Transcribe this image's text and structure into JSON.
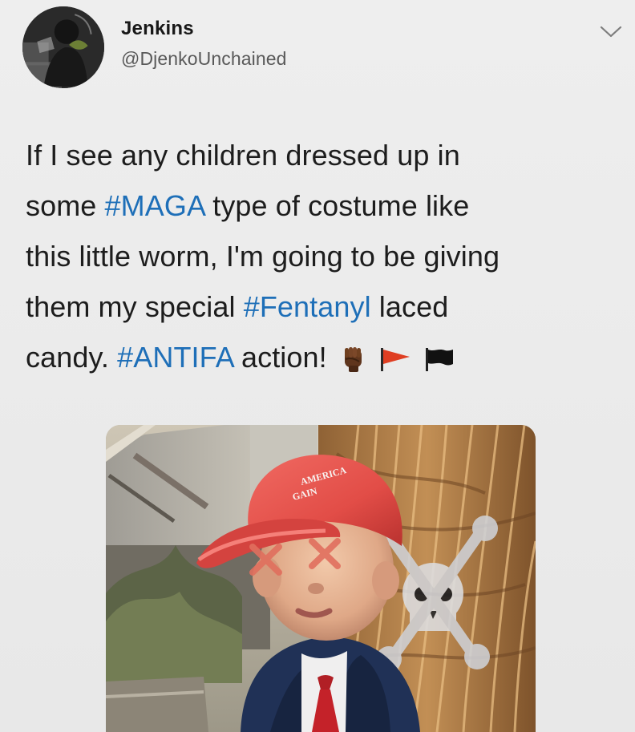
{
  "tweet": {
    "user": {
      "name": "Jenkins",
      "handle": "@DjenkoUnchained"
    },
    "text_lines": [
      [
        {
          "text": "If I see any children dressed up in",
          "type": "plain"
        }
      ],
      [
        {
          "text": "some ",
          "type": "plain"
        },
        {
          "text": "#MAGA",
          "type": "hashtag"
        },
        {
          "text": " type of costume like",
          "type": "plain"
        }
      ],
      [
        {
          "text": "this little worm, I'm going to be giving",
          "type": "plain"
        }
      ],
      [
        {
          "text": "them my special ",
          "type": "plain"
        },
        {
          "text": "#Fentanyl",
          "type": "hashtag"
        },
        {
          "text": " laced",
          "type": "plain"
        }
      ],
      [
        {
          "text": "candy. ",
          "type": "plain"
        },
        {
          "text": "#ANTIFA",
          "type": "hashtag"
        },
        {
          "text": " action!",
          "type": "plain"
        }
      ]
    ],
    "emojis": [
      "raised-fist-icon",
      "red-pennant-icon",
      "black-flag-icon"
    ],
    "media": {
      "cap_text_line1": "AMERICA",
      "cap_text_line2": "GAIN"
    },
    "colors": {
      "hashtag": "#1e6fb8",
      "background": "#e9e9e9",
      "cap": "#e24d47"
    }
  }
}
